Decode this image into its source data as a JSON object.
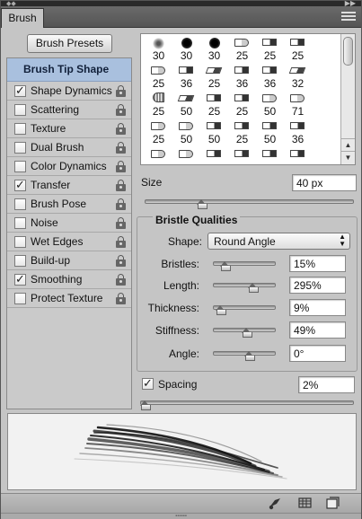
{
  "header": {
    "tab_label": "Brush",
    "grip_glyph": "◆◆",
    "collapse_glyph": "▶▶",
    "menu_icon": "panel-menu-icon"
  },
  "presets_button": "Brush Presets",
  "options": [
    {
      "label": "Brush Tip Shape",
      "selected": true,
      "checked": null,
      "lock": false
    },
    {
      "label": "Shape Dynamics",
      "checked": true,
      "lock": true
    },
    {
      "label": "Scattering",
      "checked": false,
      "lock": true
    },
    {
      "label": "Texture",
      "checked": false,
      "lock": true
    },
    {
      "label": "Dual Brush",
      "checked": false,
      "lock": true
    },
    {
      "label": "Color Dynamics",
      "checked": false,
      "lock": true
    },
    {
      "label": "Transfer",
      "checked": true,
      "lock": true
    },
    {
      "label": "Brush Pose",
      "checked": false,
      "lock": true
    },
    {
      "label": "Noise",
      "checked": false,
      "lock": true
    },
    {
      "label": "Wet Edges",
      "checked": false,
      "lock": true
    },
    {
      "label": "Build-up",
      "checked": false,
      "lock": true
    },
    {
      "label": "Smoothing",
      "checked": true,
      "lock": true
    },
    {
      "label": "Protect Texture",
      "checked": false,
      "lock": true
    }
  ],
  "brush_grid": [
    [
      {
        "n": "30",
        "i": "soft"
      },
      {
        "n": "30",
        "i": "dot"
      },
      {
        "n": "30",
        "i": "dot"
      },
      {
        "n": "25",
        "i": "tip"
      },
      {
        "n": "25",
        "i": "flat"
      },
      {
        "n": "25",
        "i": "flat"
      }
    ],
    [
      {
        "n": "25",
        "i": "tip"
      },
      {
        "n": "36",
        "i": "flat"
      },
      {
        "n": "25",
        "i": "angle"
      },
      {
        "n": "36",
        "i": "flat"
      },
      {
        "n": "36",
        "i": "flat"
      },
      {
        "n": "32",
        "i": "angle"
      }
    ],
    [
      {
        "n": "25",
        "i": "fan"
      },
      {
        "n": "50",
        "i": "angle"
      },
      {
        "n": "25",
        "i": "flat"
      },
      {
        "n": "25",
        "i": "flat"
      },
      {
        "n": "50",
        "i": "tip"
      },
      {
        "n": "71",
        "i": "tip"
      }
    ],
    [
      {
        "n": "25",
        "i": "tip"
      },
      {
        "n": "50",
        "i": "tip"
      },
      {
        "n": "50",
        "i": "flat"
      },
      {
        "n": "25",
        "i": "flat"
      },
      {
        "n": "50",
        "i": "flat"
      },
      {
        "n": "36",
        "i": "flat"
      }
    ],
    [
      {
        "n": "",
        "i": "tip"
      },
      {
        "n": "",
        "i": "tip"
      },
      {
        "n": "",
        "i": "flat"
      },
      {
        "n": "",
        "i": "flat"
      },
      {
        "n": "",
        "i": "flat"
      },
      {
        "n": "",
        "i": "flat"
      }
    ]
  ],
  "size": {
    "label": "Size",
    "value": "40 px",
    "level": 0.27
  },
  "bristle": {
    "title": "Bristle Qualities",
    "shape_label": "Shape:",
    "shape_value": "Round Angle",
    "rows": [
      {
        "label": "Bristles:",
        "value": "15%",
        "level": 0.08
      },
      {
        "label": "Length:",
        "value": "295%",
        "level": 0.56
      },
      {
        "label": "Thickness:",
        "value": "9%",
        "level": 0.0
      },
      {
        "label": "Stiffness:",
        "value": "49%",
        "level": 0.45
      },
      {
        "label": "Angle:",
        "value": "0°",
        "level": 0.5
      }
    ]
  },
  "spacing": {
    "label": "Spacing",
    "checked": true,
    "value": "2%",
    "level": 0.0
  },
  "bottom_icons": [
    "brush-cleanup-icon",
    "grid-toggle-icon",
    "new-preset-icon"
  ],
  "colors": {
    "selected_row": "#a9c0de",
    "panel": "#c5c5c5"
  }
}
